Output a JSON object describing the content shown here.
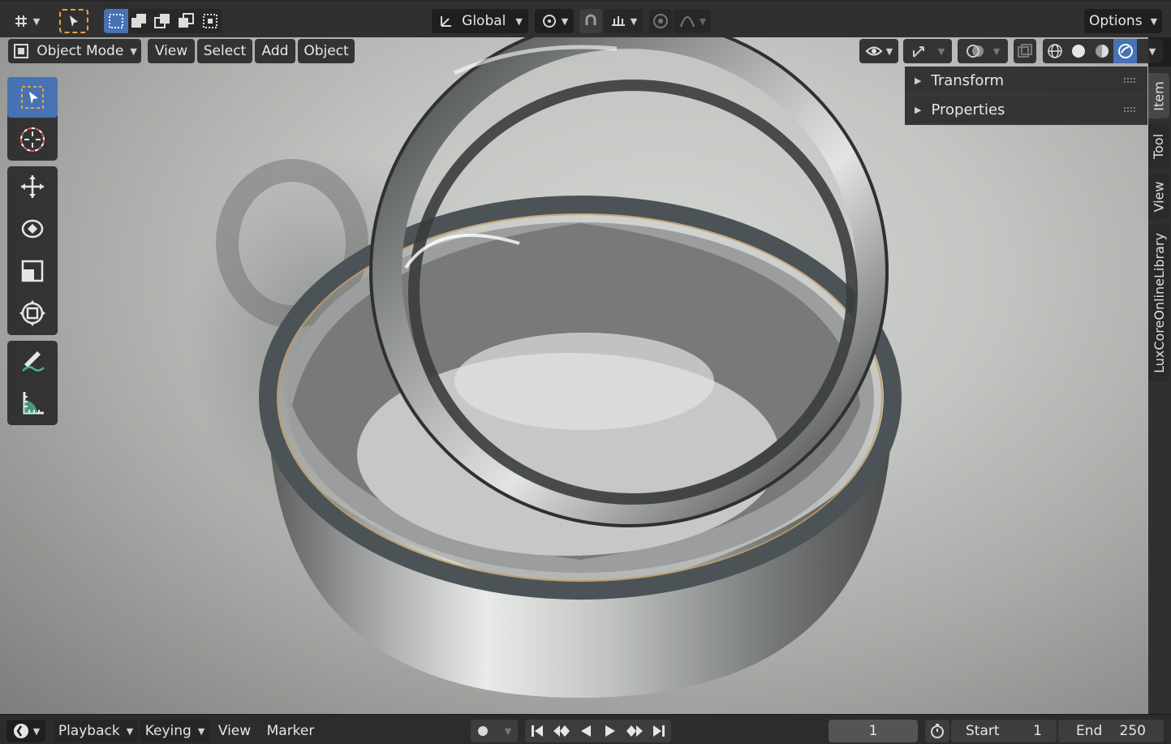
{
  "header": {
    "orientation": "Global",
    "options_label": "Options"
  },
  "viewport_header": {
    "mode_label": "Object Mode",
    "menus": [
      "View",
      "Select",
      "Add",
      "Object"
    ]
  },
  "sidebar": {
    "panels": [
      "Transform",
      "Properties"
    ],
    "tabs": [
      "Item",
      "Tool",
      "View",
      "LuxCoreOnlineLibrary"
    ],
    "active_tab": "Item"
  },
  "timeline": {
    "menus": [
      "Playback",
      "Keying",
      "View",
      "Marker"
    ],
    "current_frame": "1",
    "start_label": "Start",
    "start_value": "1",
    "end_label": "End",
    "end_value": "250"
  },
  "colors": {
    "accent": "#4772b3",
    "header_bg": "#303030",
    "select_outline": "#e8a33c"
  }
}
